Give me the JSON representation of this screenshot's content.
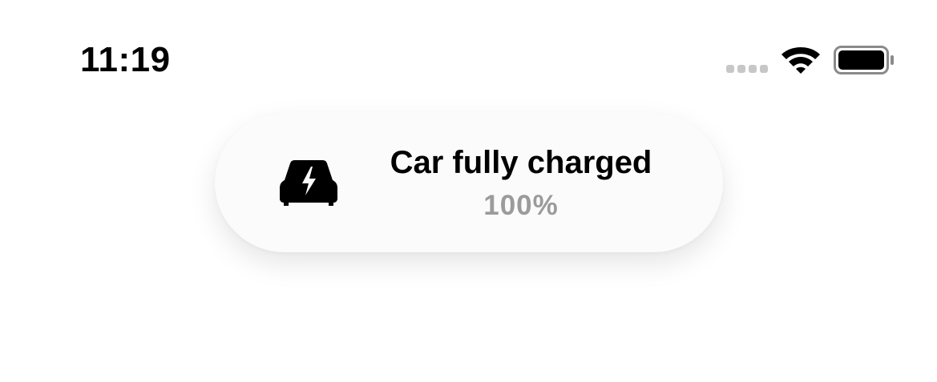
{
  "status_bar": {
    "time": "11:19",
    "signal_icon": "cellular-signal-icon",
    "wifi_icon": "wifi-icon",
    "battery_icon": "battery-icon",
    "signal_color": "#c7c7c7"
  },
  "toast": {
    "icon": "car-charging-icon",
    "title": "Car fully charged",
    "subtitle": "100%",
    "subtitle_color": "#9b9b9b"
  }
}
